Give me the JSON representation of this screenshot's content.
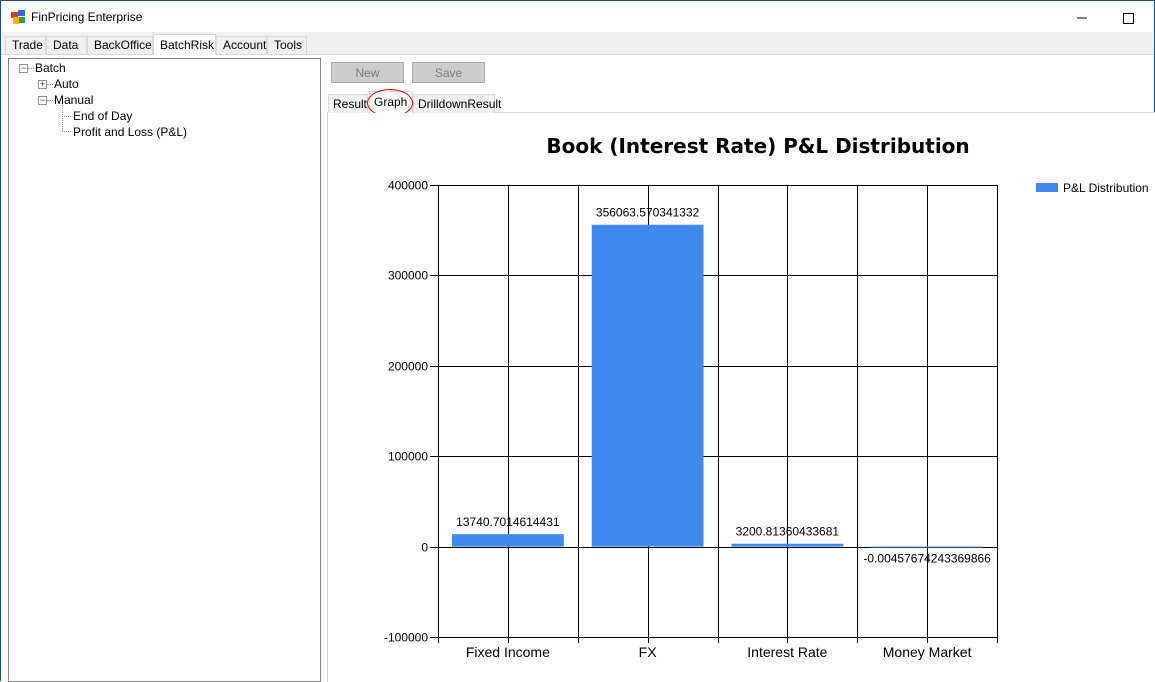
{
  "window": {
    "title": "FinPricing Enterprise"
  },
  "menu_tabs": [
    {
      "label": "Trade"
    },
    {
      "label": "Data"
    },
    {
      "label": "BackOffice"
    },
    {
      "label": "BatchRisk",
      "active": true
    },
    {
      "label": "Account"
    },
    {
      "label": "Tools"
    }
  ],
  "tree": {
    "root": "Batch",
    "auto": "Auto",
    "manual": "Manual",
    "end_of_day": "End of Day",
    "pnl": "Profit and Loss (P&L)"
  },
  "buttons": {
    "new": "New",
    "save": "Save"
  },
  "sub_tabs": [
    {
      "label": "Result"
    },
    {
      "label": "Graph",
      "active": true
    },
    {
      "label": "DrilldownResult"
    }
  ],
  "colors": {
    "bar": "#4189ee",
    "annotation": "#e00000"
  },
  "chart_data": {
    "type": "bar",
    "title": "Book (Interest Rate) P&L Distribution",
    "categories": [
      "Fixed Income",
      "FX",
      "Interest Rate",
      "Money Market"
    ],
    "series": [
      {
        "name": "P&L Distribution",
        "values": [
          13740.7014614431,
          356063.570341332,
          3200.81360433681,
          -0.00457674243369866
        ],
        "labels": [
          "13740.7014614431",
          "356063.570341332",
          "3200.81360433681",
          "-0.00457674243369866"
        ]
      }
    ],
    "ylim": [
      -100000,
      400000
    ],
    "yticks": [
      400000,
      300000,
      200000,
      100000,
      0,
      -100000
    ],
    "ytick_labels": [
      "400000",
      "300000",
      "200000",
      "100000",
      "0",
      "-100000"
    ],
    "grid": true,
    "legend": "top-right"
  }
}
